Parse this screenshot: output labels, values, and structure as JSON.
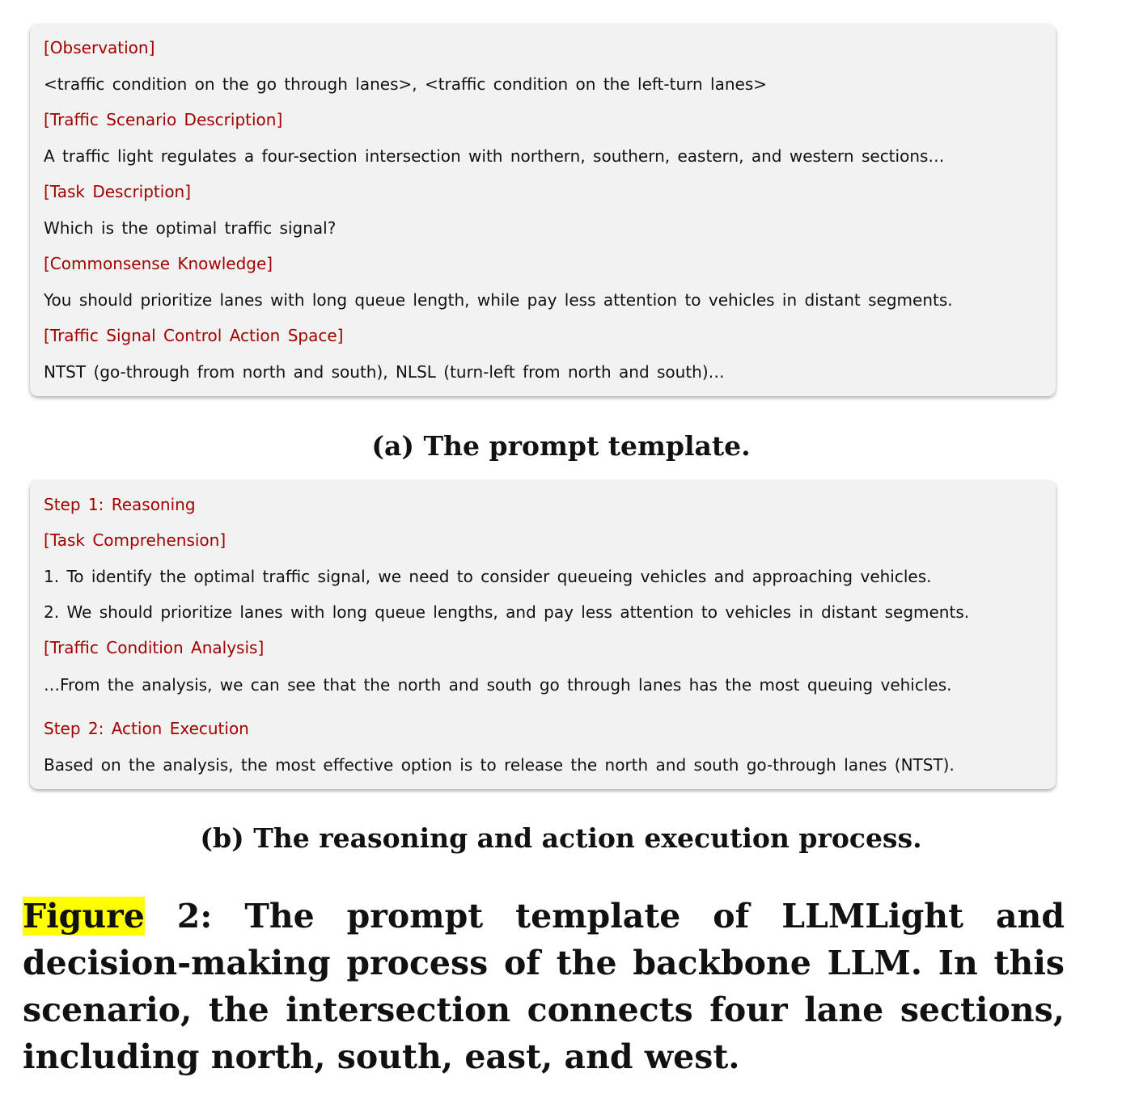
{
  "panel_a": {
    "lines": [
      {
        "text": "[Observation]",
        "heading": true
      },
      {
        "text": "<traffic condition on the go through lanes>, <traffic condition on the left-turn lanes>",
        "heading": false
      },
      {
        "text": "[Traffic Scenario Description]",
        "heading": true
      },
      {
        "text": "A traffic light regulates a four-section intersection with northern, southern, eastern, and western sections…",
        "heading": false
      },
      {
        "text": "[Task Description]",
        "heading": true
      },
      {
        "text": "Which is the optimal traffic signal?",
        "heading": false
      },
      {
        "text": "[Commonsense Knowledge]",
        "heading": true
      },
      {
        "text": "You should prioritize lanes with long queue length, while pay less attention to vehicles in distant segments.",
        "heading": false
      },
      {
        "text": "[Traffic Signal Control Action Space]",
        "heading": true
      },
      {
        "text": "NTST (go-through from north and south), NLSL (turn-left from north and south)…",
        "heading": false
      }
    ],
    "caption": "(a) The prompt template."
  },
  "panel_b": {
    "lines": [
      {
        "text": "Step 1: Reasoning",
        "heading": true
      },
      {
        "text": "[Task Comprehension]",
        "heading": true
      },
      {
        "text": "1. To identify the optimal traffic signal, we need to consider queueing vehicles and approaching vehicles.",
        "heading": false
      },
      {
        "text": "2. We should prioritize lanes with long queue lengths, and pay less attention to vehicles in distant segments.",
        "heading": false
      },
      {
        "text": "[Traffic Condition Analysis]",
        "heading": true
      },
      {
        "text": "…From the analysis, we can see that the north and south go through lanes has the most queuing vehicles.",
        "heading": false
      },
      {
        "text": "Step 2: Action Execution",
        "heading": true
      },
      {
        "text": "Based on the analysis, the most effective option is to release the north and south go-through lanes (NTST).",
        "heading": false
      }
    ],
    "caption": "(b) The reasoning and action execution process."
  },
  "figure_caption": {
    "label": "Figure",
    "text": " 2: The prompt template of LLMLight and decision-making process of the backbone LLM. In this scenario, the intersection connects four lane sections, including north, south, east, and west."
  },
  "colors": {
    "heading": "#a30000",
    "box": "#f2f2f2",
    "highlight": "#ffff00"
  }
}
